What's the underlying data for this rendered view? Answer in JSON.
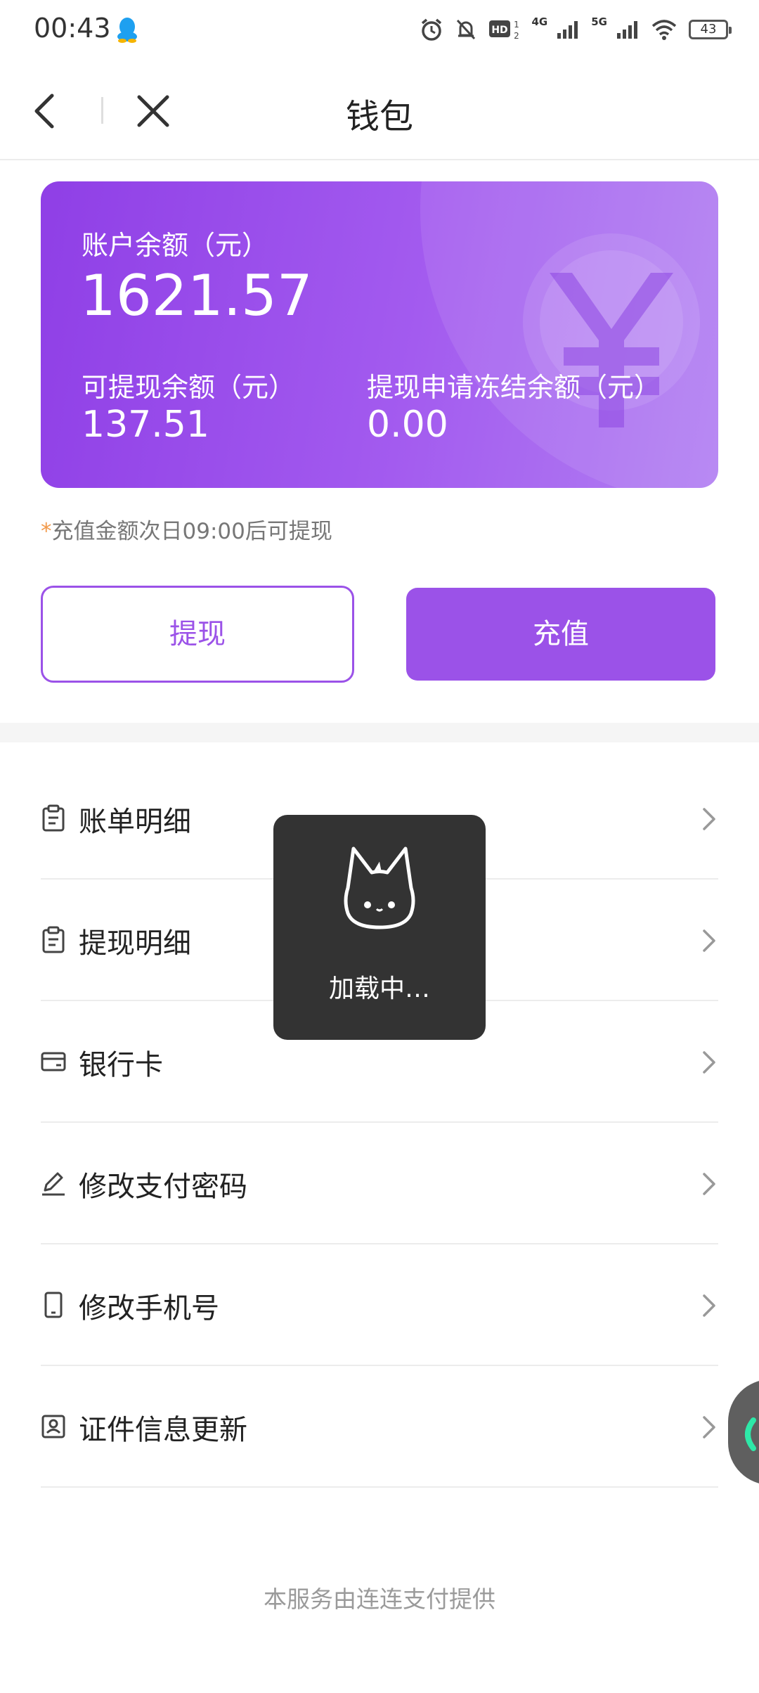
{
  "status_bar": {
    "time": "00:43",
    "battery": "43",
    "network_1": "4G",
    "network_2": "5G",
    "icons": [
      "qq-icon",
      "alarm-icon",
      "mute-icon",
      "hd-icon",
      "signal-4g-icon",
      "signal-5g-icon",
      "wifi-icon",
      "battery-icon"
    ]
  },
  "header": {
    "title": "钱包",
    "back_icon": "chevron-left-icon",
    "close_icon": "close-icon"
  },
  "balance_card": {
    "balance_label": "账户余额（元）",
    "balance_value": "1621.57",
    "withdrawable_label": "可提现余额（元）",
    "withdrawable_value": "137.51",
    "frozen_label": "提现申请冻结余额（元）",
    "frozen_value": "0.00",
    "decoration_icon": "yuan-icon",
    "colors": {
      "start": "#8f3fe6",
      "end": "#b17ff2"
    }
  },
  "notice": {
    "star": "*",
    "text": "充值金额次日09:00后可提现"
  },
  "actions": {
    "withdraw_label": "提现",
    "recharge_label": "充值",
    "accent": "#9b52e8"
  },
  "menu": {
    "items": [
      {
        "label": "账单明细",
        "icon": "clipboard-icon"
      },
      {
        "label": "提现明细",
        "icon": "clipboard-icon"
      },
      {
        "label": "银行卡",
        "icon": "card-icon"
      },
      {
        "label": "修改支付密码",
        "icon": "pen-icon"
      },
      {
        "label": "修改手机号",
        "icon": "phone-icon"
      },
      {
        "label": "证件信息更新",
        "icon": "id-card-icon"
      }
    ]
  },
  "loading_toast": {
    "text": "加载中…"
  },
  "footer": {
    "text": "本服务由连连支付提供"
  }
}
